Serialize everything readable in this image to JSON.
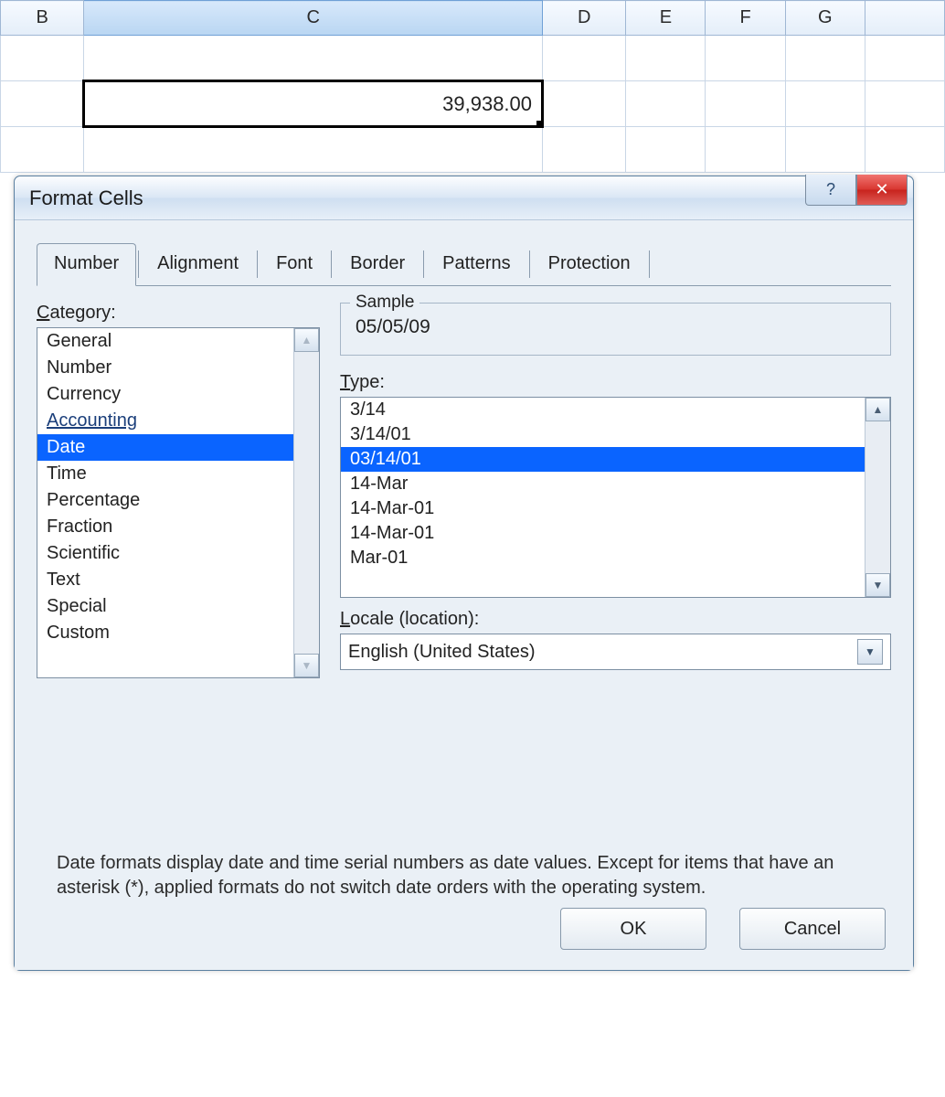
{
  "columns": [
    "B",
    "C",
    "D",
    "E",
    "F",
    "G"
  ],
  "selected_column_index": 1,
  "cell_value": "39,938.00",
  "dialog": {
    "title": "Format Cells",
    "tabs": [
      "Number",
      "Alignment",
      "Font",
      "Border",
      "Patterns",
      "Protection"
    ],
    "active_tab_index": 0,
    "category_label": "Category:",
    "categories": [
      "General",
      "Number",
      "Currency",
      "Accounting",
      "Date",
      "Time",
      "Percentage",
      "Fraction",
      "Scientific",
      "Text",
      "Special",
      "Custom"
    ],
    "selected_category_index": 4,
    "sample_label": "Sample",
    "sample_value": "05/05/09",
    "type_label": "Type:",
    "types": [
      "3/14",
      "3/14/01",
      "03/14/01",
      "14-Mar",
      "14-Mar-01",
      "14-Mar-01",
      "Mar-01"
    ],
    "selected_type_index": 2,
    "locale_label": "Locale (location):",
    "locale_value": "English (United States)",
    "description": "Date formats display date and time serial numbers as date values. Except for items that have an asterisk (*), applied formats do not switch date orders with the operating system.",
    "ok_label": "OK",
    "cancel_label": "Cancel",
    "help_glyph": "?",
    "close_glyph": "✕"
  }
}
